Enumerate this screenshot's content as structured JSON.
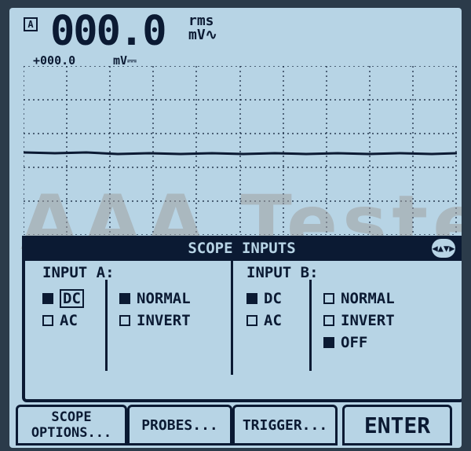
{
  "screen": {
    "channel_badge": "A",
    "main_reading": "000.0",
    "unit_top": "rms",
    "unit_bottom": "mV∿",
    "sub_reading": "+000.0",
    "sub_unit": "mV⎓"
  },
  "watermark": "AAA Testers",
  "panel": {
    "title": "SCOPE INPUTS",
    "nav_icon": "up-down-left-right-icon",
    "input_a": {
      "label": "INPUT A:",
      "coupling": [
        {
          "label": "DC",
          "selected": true
        },
        {
          "label": "AC",
          "selected": false
        }
      ],
      "mode": [
        {
          "label": "NORMAL",
          "selected": true
        },
        {
          "label": "INVERT",
          "selected": false
        }
      ]
    },
    "input_b": {
      "label": "INPUT B:",
      "coupling": [
        {
          "label": "DC",
          "selected": true
        },
        {
          "label": "AC",
          "selected": false
        }
      ],
      "mode": [
        {
          "label": "NORMAL",
          "selected": false
        },
        {
          "label": "INVERT",
          "selected": false
        },
        {
          "label": "OFF",
          "selected": true
        }
      ]
    }
  },
  "softkeys": {
    "f1_line1": "SCOPE",
    "f1_line2": "OPTIONS...",
    "f2": "PROBES...",
    "f3": "TRIGGER...",
    "f4": "ENTER"
  },
  "colors": {
    "lcd_background": "#b7d4e5",
    "lcd_foreground": "#0b1a33"
  }
}
